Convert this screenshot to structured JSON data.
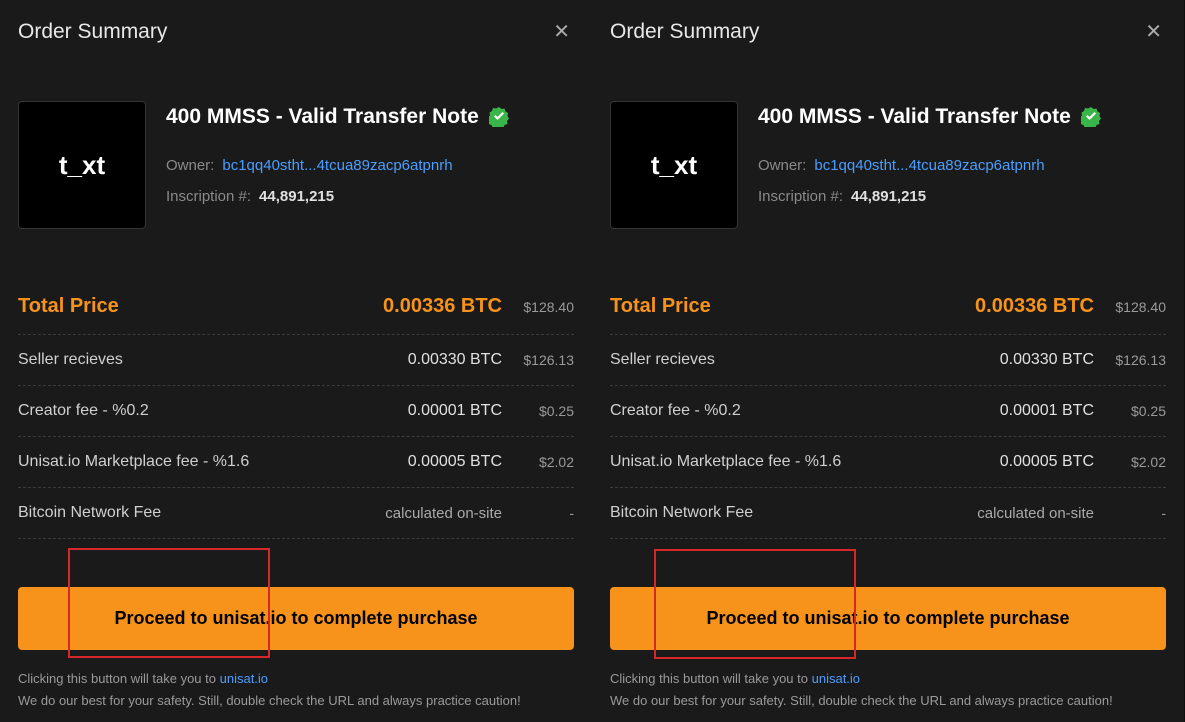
{
  "header": {
    "title": "Order Summary"
  },
  "item": {
    "thumb_text": "t_xt",
    "title": "400 MMSS - Valid Transfer Note",
    "owner_label": "Owner:",
    "owner_address": "bc1qq40stht...4tcua89zacp6atpnrh",
    "inscription_label": "Inscription #:",
    "inscription_number": "44,891,215"
  },
  "prices": {
    "total": {
      "label": "Total Price",
      "btc": "0.00336 BTC",
      "usd": "$128.40"
    },
    "seller": {
      "label": "Seller recieves",
      "btc": "0.00330 BTC",
      "usd": "$126.13"
    },
    "creator": {
      "label": "Creator fee - %0.2",
      "btc": "0.00001 BTC",
      "usd": "$0.25"
    },
    "marketplace": {
      "label": "Unisat.io Marketplace fee - %1.6",
      "btc": "0.00005 BTC",
      "usd": "$2.02"
    },
    "network": {
      "label": "Bitcoin Network Fee",
      "btc": "calculated on-site",
      "usd": "-"
    }
  },
  "cta": {
    "button": "Proceed to unisat.io to complete purchase",
    "footer_prefix": "Clicking this button will take you to ",
    "footer_link": "unisat.io",
    "footer_caution": "We do our best for your safety. Still, double check the URL and always practice caution!"
  }
}
